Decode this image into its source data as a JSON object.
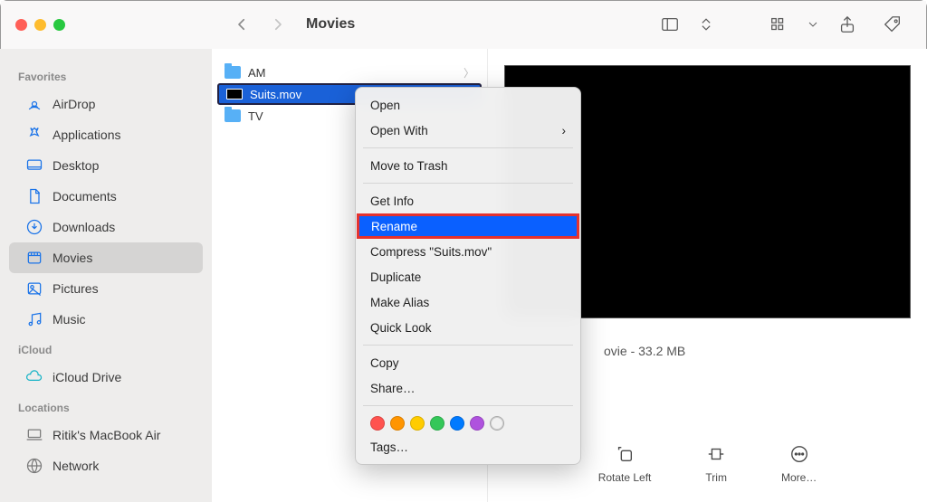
{
  "window": {
    "title": "Movies"
  },
  "traffic": {
    "close": "close-window",
    "min": "minimize-window",
    "max": "zoom-window"
  },
  "sidebar": {
    "sections": [
      {
        "heading": "Favorites",
        "items": [
          {
            "label": "AirDrop",
            "icon": "airdrop-icon"
          },
          {
            "label": "Applications",
            "icon": "applications-icon"
          },
          {
            "label": "Desktop",
            "icon": "desktop-icon"
          },
          {
            "label": "Documents",
            "icon": "documents-icon"
          },
          {
            "label": "Downloads",
            "icon": "downloads-icon"
          },
          {
            "label": "Movies",
            "icon": "movies-icon",
            "selected": true
          },
          {
            "label": "Pictures",
            "icon": "pictures-icon"
          },
          {
            "label": "Music",
            "icon": "music-icon"
          }
        ]
      },
      {
        "heading": "iCloud",
        "items": [
          {
            "label": "iCloud Drive",
            "icon": "icloud-icon"
          }
        ]
      },
      {
        "heading": "Locations",
        "items": [
          {
            "label": "Ritik's MacBook Air",
            "icon": "laptop-icon"
          },
          {
            "label": "Network",
            "icon": "network-icon"
          }
        ]
      }
    ]
  },
  "file_list": {
    "items": [
      {
        "name": "AM",
        "kind": "folder",
        "selected": false
      },
      {
        "name": "Suits.mov",
        "kind": "movie",
        "selected": true
      },
      {
        "name": "TV",
        "kind": "folder",
        "selected": false
      }
    ]
  },
  "preview": {
    "meta_suffix": "ovie - 33.2 MB",
    "actions": [
      {
        "label": "Rotate Left",
        "icon": "rotate-left-icon"
      },
      {
        "label": "Trim",
        "icon": "trim-icon"
      },
      {
        "label": "More…",
        "icon": "more-icon"
      }
    ]
  },
  "context_menu": {
    "items": [
      {
        "label": "Open"
      },
      {
        "label": "Open With",
        "submenu": true
      },
      {
        "sep": true
      },
      {
        "label": "Move to Trash"
      },
      {
        "sep": true
      },
      {
        "label": "Get Info"
      },
      {
        "label": "Rename",
        "hovered": true,
        "annotation_highlighted": true
      },
      {
        "label": "Compress \"Suits.mov\""
      },
      {
        "label": "Duplicate"
      },
      {
        "label": "Make Alias"
      },
      {
        "label": "Quick Look"
      },
      {
        "sep": true
      },
      {
        "label": "Copy"
      },
      {
        "label": "Share…"
      },
      {
        "sep": true
      },
      {
        "type": "tags",
        "colors": [
          "#ff534f",
          "#ff9500",
          "#ffcc00",
          "#34c759",
          "#007aff",
          "#af52de",
          "transparent"
        ]
      },
      {
        "label": "Tags…"
      }
    ]
  },
  "toolbar_buttons": {
    "back": "‹",
    "forward": "›",
    "sidebar_toggle": "toggle-sidebar",
    "view_mode": "view-options",
    "group": "group-by",
    "share": "share",
    "tag": "edit-tags"
  }
}
